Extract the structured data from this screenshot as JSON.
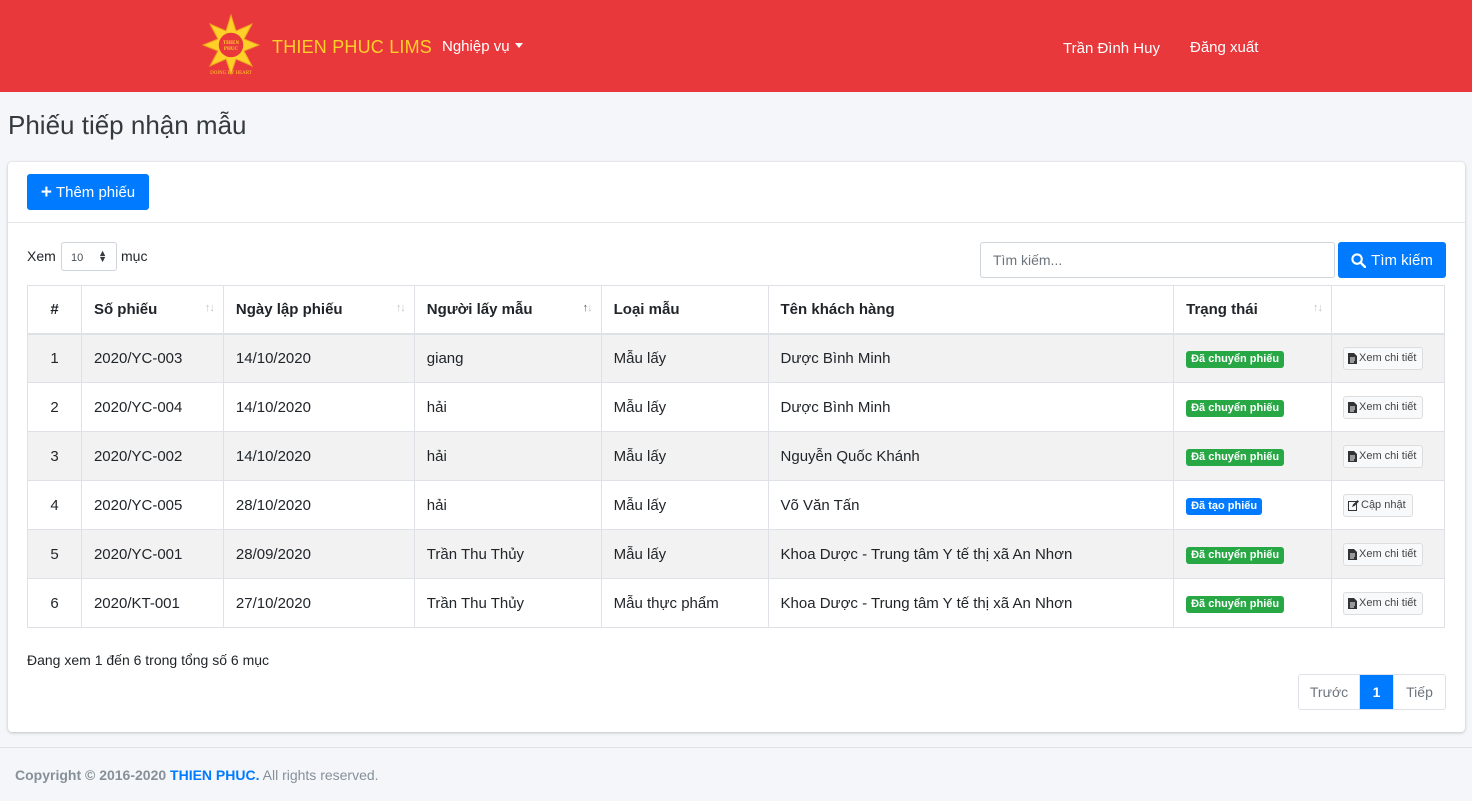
{
  "navbar": {
    "brand": "THIEN PHUC LIMS",
    "logo_text_top": "THIEN PHUC",
    "logo_text_bottom": "DOING BY HEART",
    "menu_label": "Nghiệp vụ",
    "user_name": "Trần Đình Huy",
    "logout_label": "Đăng xuất",
    "bg_color": "#e8383b"
  },
  "page": {
    "title": "Phiếu tiếp nhận mẫu"
  },
  "toolbar": {
    "add_label": "Thêm phiếu",
    "add_icon": "plus-icon"
  },
  "list_controls": {
    "show_prefix": "Xem",
    "page_size": "10",
    "show_suffix": "mục",
    "search_placeholder": "Tìm kiếm...",
    "search_button": "Tìm kiếm",
    "search_icon": "search-icon"
  },
  "table": {
    "columns": [
      "#",
      "Số phiếu",
      "Ngày lập phiếu",
      "Người lấy mẫu",
      "Loại mẫu",
      "Tên khách hàng",
      "Trạng thái",
      ""
    ],
    "rows": [
      {
        "idx": "1",
        "code": "2020/YC-003",
        "date": "14/10/2020",
        "collector": "giang",
        "type": "Mẫu lấy",
        "customer": "Dược Bình Minh",
        "status": "Đã chuyển phiếu",
        "status_kind": "success",
        "action": "Xem chi tiết",
        "action_icon": "document-icon"
      },
      {
        "idx": "2",
        "code": "2020/YC-004",
        "date": "14/10/2020",
        "collector": "hải",
        "type": "Mẫu lấy",
        "customer": "Dược Bình Minh",
        "status": "Đã chuyển phiếu",
        "status_kind": "success",
        "action": "Xem chi tiết",
        "action_icon": "document-icon"
      },
      {
        "idx": "3",
        "code": "2020/YC-002",
        "date": "14/10/2020",
        "collector": "hải",
        "type": "Mẫu lấy",
        "customer": "Nguyễn Quốc Khánh",
        "status": "Đã chuyển phiếu",
        "status_kind": "success",
        "action": "Xem chi tiết",
        "action_icon": "document-icon"
      },
      {
        "idx": "4",
        "code": "2020/YC-005",
        "date": "28/10/2020",
        "collector": "hải",
        "type": "Mẫu lấy",
        "customer": "Võ Văn Tấn",
        "status": "Đã tạo phiếu",
        "status_kind": "primary",
        "action": "Cập nhật",
        "action_icon": "edit-icon"
      },
      {
        "idx": "5",
        "code": "2020/YC-001",
        "date": "28/09/2020",
        "collector": "Trần Thu Thủy",
        "type": "Mẫu lấy",
        "customer": "Khoa Dược - Trung tâm Y tế thị xã An Nhơn",
        "status": "Đã chuyển phiếu",
        "status_kind": "success",
        "action": "Xem chi tiết",
        "action_icon": "document-icon"
      },
      {
        "idx": "6",
        "code": "2020/KT-001",
        "date": "27/10/2020",
        "collector": "Trần Thu Thủy",
        "type": "Mẫu thực phẩm",
        "customer": "Khoa Dược - Trung tâm Y tế thị xã An Nhơn",
        "status": "Đã chuyển phiếu",
        "status_kind": "success",
        "action": "Xem chi tiết",
        "action_icon": "document-icon"
      }
    ]
  },
  "table_info": "Đang xem 1 đến 6 trong tổng số 6 mục",
  "pagination": {
    "prev": "Trước",
    "current": "1",
    "next": "Tiếp"
  },
  "footer": {
    "copyright": "Copyright © 2016-2020",
    "company": "THIEN PHUC.",
    "rights": "All rights reserved."
  },
  "colors": {
    "primary": "#007bff",
    "success": "#28a745",
    "brand_yellow": "#ffd028"
  }
}
